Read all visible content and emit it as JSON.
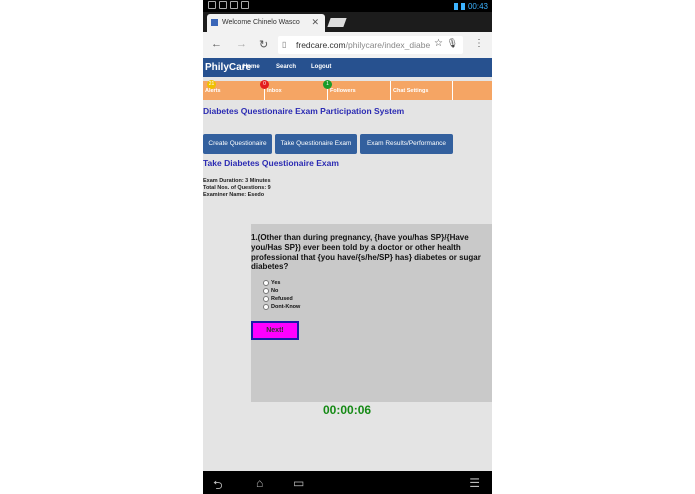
{
  "status_bar": {
    "time": "00:43"
  },
  "browser": {
    "tab_title": "Welcome Chinelo Wasco",
    "url_domain": "fredcare.com",
    "url_path": "/philycare/index_diabe"
  },
  "site": {
    "brand": "PhilyCare",
    "nav": {
      "home": "Home",
      "search": "Search",
      "logout": "Logout"
    },
    "orange_bar": [
      {
        "label": "Alerts",
        "badge": "21"
      },
      {
        "label": "Inbox",
        "badge": "0"
      },
      {
        "label": "Followers",
        "badge": "1"
      },
      {
        "label": "Chat Settings"
      }
    ]
  },
  "page": {
    "title": "Diabetes Questionaire Exam Participation System",
    "buttons": {
      "create": "Create Questionaire",
      "take": "Take Questionaire Exam",
      "results": "Exam Results/Performance"
    },
    "exam_title": "Take Diabetes Questionaire Exam",
    "meta": {
      "duration": "Exam Duration: 3 Minutes",
      "total": "Total Nos. of Questions: 9",
      "examiner": "Examiner Name: Esedo"
    },
    "question": "1.(Other than during pregnancy, {have you/has SP}/{Have you/Has SP}) ever been told by a doctor or other health professional that {you have/{s/he/SP} has} diabetes or sugar diabetes?",
    "options": [
      "Yes",
      "No",
      "Refused",
      "Dont-Know"
    ],
    "next_label": "Next!",
    "timer": "00:00:06"
  },
  "colors": {
    "navbar": "#27518f",
    "orange_bar": "#f5a564",
    "heading": "#2b2bb3",
    "button": "#33609e",
    "next_button": "#ff00ff",
    "timer": "#158a15"
  }
}
